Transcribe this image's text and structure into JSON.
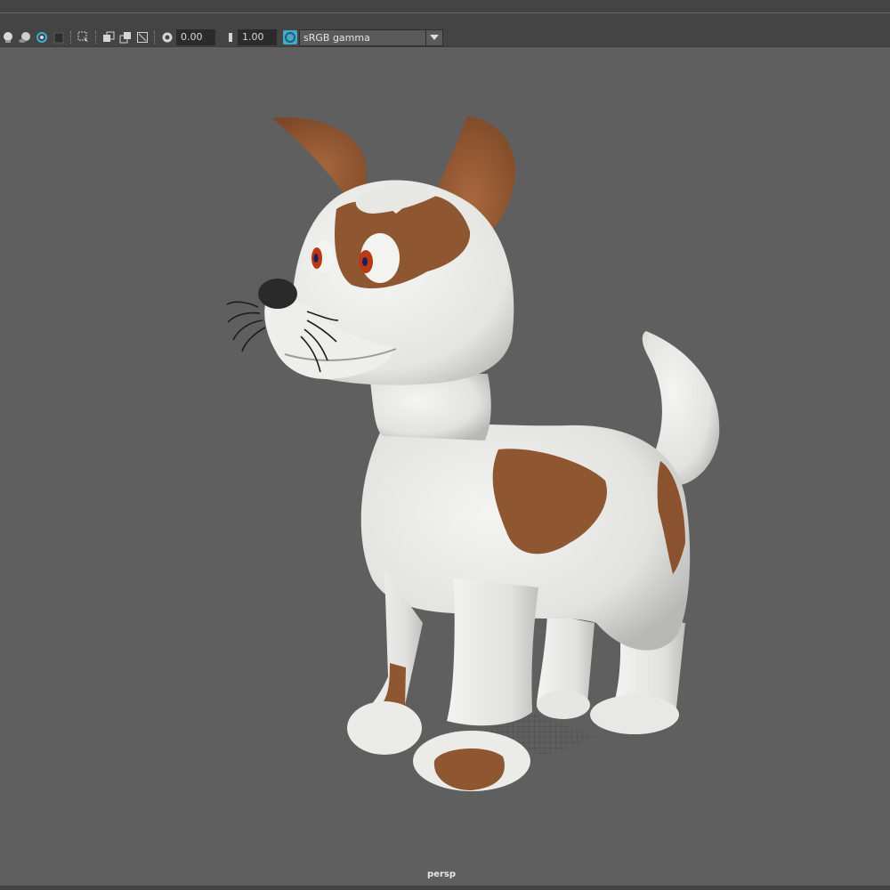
{
  "toolbar": {
    "exposure_value": "0.00",
    "gamma_value": "1.00",
    "color_management_label": "sRGB gamma"
  },
  "viewport": {
    "camera_label": "persp"
  },
  "colors": {
    "panel": "#444444",
    "viewport_bg": "#5f5f5f",
    "accent_blue": "#47a9c9",
    "dog_brown": "#8f5632",
    "dog_white": "#e9e9e6"
  },
  "icons": [
    "lights-icon",
    "shadows-icon",
    "ambient-occlusion-icon",
    "motion-blur-icon",
    "isolate-select-icon",
    "xray-icon",
    "xray-joints-icon",
    "backface-icon",
    "exposure-icon",
    "gamma-icon",
    "color-management-icon",
    "dropdown-arrow-icon"
  ]
}
